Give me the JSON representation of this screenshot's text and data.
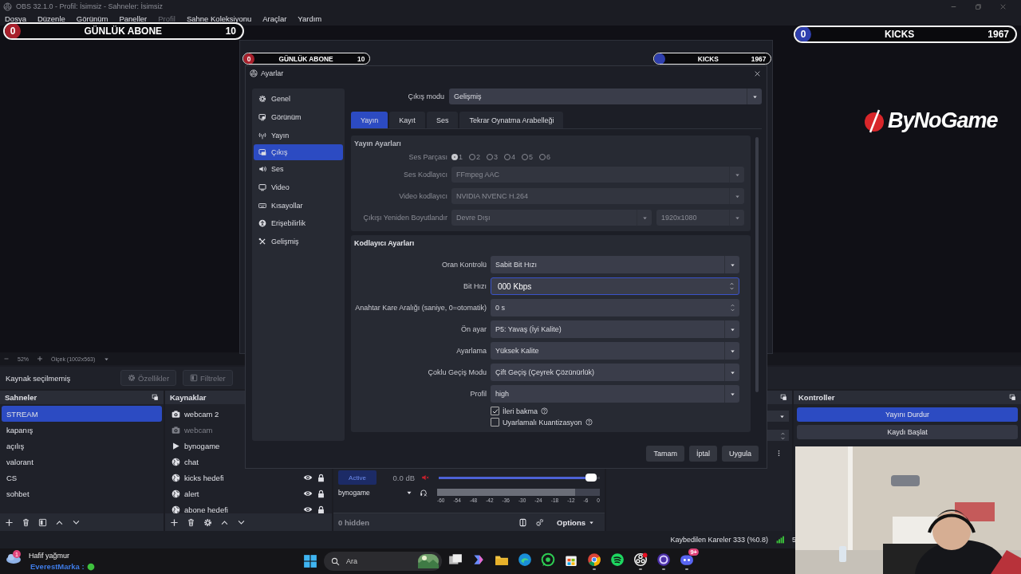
{
  "window": {
    "title": "OBS 32.1.0 - Profil: İsimsiz - Sahneler: İsimsiz"
  },
  "menu": [
    {
      "label": "Dosya",
      "disabled": false
    },
    {
      "label": "Düzenle",
      "disabled": false
    },
    {
      "label": "Görünüm",
      "disabled": false
    },
    {
      "label": "Paneller",
      "disabled": false
    },
    {
      "label": "Profil",
      "disabled": true
    },
    {
      "label": "Sahne Koleksiyonu",
      "disabled": false
    },
    {
      "label": "Araçlar",
      "disabled": false
    },
    {
      "label": "Yardım",
      "disabled": false
    }
  ],
  "overlays": [
    {
      "count": "0",
      "label": "GÜNLÜK ABONE",
      "goal": "10",
      "color": "#a8202c"
    },
    {
      "count": "0",
      "label": "KICKS",
      "goal": "1967",
      "color": "#2f3fae"
    }
  ],
  "preview": {
    "logo": "ByNoGame",
    "nested_overlays": [
      {
        "count": "0",
        "label": "GÜNLÜK ABONE",
        "goal": "10",
        "color": "#a8202c"
      },
      {
        "label": "KICKS",
        "goal": "1967",
        "color": "#2f3fae"
      }
    ]
  },
  "zoom_bar": {
    "zoom": "52%",
    "scale": "Ölçek (1002x563)"
  },
  "source_toolbar": {
    "status": "Kaynak seçilmemiş",
    "buttons": [
      {
        "label": "Özellikler",
        "disabled": true
      },
      {
        "label": "Filtreler",
        "disabled": true
      }
    ]
  },
  "scenes": {
    "title": "Sahneler",
    "items": [
      {
        "label": "STREAM",
        "selected": true
      },
      {
        "label": "kapanış",
        "selected": false
      },
      {
        "label": "açılış",
        "selected": false
      },
      {
        "label": "valorant",
        "selected": false
      },
      {
        "label": "CS",
        "selected": false
      },
      {
        "label": "sohbet",
        "selected": false
      }
    ]
  },
  "sources": {
    "title": "Kaynaklar",
    "items": [
      {
        "label": "webcam 2",
        "kind": "camera",
        "visible": true
      },
      {
        "label": "webcam",
        "kind": "camera",
        "visible": false
      },
      {
        "label": "bynogame",
        "kind": "media",
        "visible": true
      },
      {
        "label": "chat",
        "kind": "browser",
        "visible": true
      },
      {
        "label": "kicks hedefi",
        "kind": "browser",
        "visible": true,
        "controls": true
      },
      {
        "label": "alert",
        "kind": "browser",
        "visible": true,
        "controls": true
      },
      {
        "label": "abone hedefi",
        "kind": "browser",
        "visible": true,
        "controls": true
      }
    ]
  },
  "mixer": {
    "channel": {
      "status": "Active",
      "volume": "0.0 dB",
      "level": 0.98,
      "name": "bynogame",
      "muted": true,
      "meter": {
        "level": 0.85,
        "ticks": [
          "-60",
          "-54",
          "-48",
          "-42",
          "-36",
          "-30",
          "-24",
          "-18",
          "-12",
          "-6",
          "0"
        ]
      }
    },
    "hidden": "0 hidden",
    "options": "Options"
  },
  "controls": {
    "title": "Kontroller",
    "buttons": [
      {
        "label": "Yayını Durdur",
        "active": true
      },
      {
        "label": "Kaydı Başlat",
        "active": false
      }
    ]
  },
  "status_bar": {
    "dropped_frames": "Kaybedilen Kareler 333 (%0.8)",
    "cut_text": "5"
  },
  "taskbar": {
    "weather": "Hafif yağmur",
    "weather_badge": "1",
    "chat_overlay": "EverestMarka :",
    "search": {
      "placeholder": "Ara"
    },
    "apps": [
      {
        "kind": "taskview",
        "active": false
      },
      {
        "kind": "copilot",
        "active": false
      },
      {
        "kind": "folder",
        "active": false
      },
      {
        "kind": "edge",
        "active": false
      },
      {
        "kind": "whatsapp",
        "active": false
      },
      {
        "kind": "store",
        "active": false
      },
      {
        "kind": "chrome",
        "active": true
      },
      {
        "kind": "spotify",
        "active": false
      },
      {
        "kind": "obs",
        "active": true
      },
      {
        "kind": "ring",
        "active": true
      },
      {
        "kind": "discord",
        "active": true,
        "badge": "9+"
      }
    ]
  },
  "settings": {
    "title": "Ayarlar",
    "nav": [
      {
        "label": "Genel",
        "selected": false
      },
      {
        "label": "Görünüm",
        "selected": false
      },
      {
        "label": "Yayın",
        "selected": false
      },
      {
        "label": "Çıkış",
        "selected": true
      },
      {
        "label": "Ses",
        "selected": false
      },
      {
        "label": "Video",
        "selected": false
      },
      {
        "label": "Kısayollar",
        "selected": false
      },
      {
        "label": "Erişebilirlik",
        "selected": false
      },
      {
        "label": "Gelişmiş",
        "selected": false
      }
    ],
    "output_mode": {
      "label": "Çıkış modu",
      "value": "Gelişmiş"
    },
    "tabs": [
      {
        "label": "Yayın",
        "selected": true
      },
      {
        "label": "Kayıt",
        "selected": false
      },
      {
        "label": "Ses",
        "selected": false
      },
      {
        "label": "Tekrar Oynatma Arabelleği",
        "selected": false
      }
    ],
    "stream_group": {
      "title": "Yayın Ayarları",
      "disabled": true,
      "audio_track": {
        "label": "Ses Parçası",
        "options": [
          {
            "label": "1",
            "selected": true
          },
          {
            "label": "2",
            "selected": false
          },
          {
            "label": "3",
            "selected": false
          },
          {
            "label": "4",
            "selected": false
          },
          {
            "label": "5",
            "selected": false
          },
          {
            "label": "6",
            "selected": false
          }
        ]
      },
      "rows": [
        {
          "label": "Ses Kodlayıcı",
          "values": [
            "FFmpeg AAC"
          ]
        },
        {
          "label": "Video kodlayıcı",
          "values": [
            "NVIDIA NVENC H.264"
          ]
        },
        {
          "label": "Çıkışı Yeniden Boyutlandır",
          "values": [
            "Devre Dışı",
            "1920x1080"
          ]
        }
      ]
    },
    "encoder_group": {
      "title": "Kodlayıcı Ayarları",
      "rows": [
        {
          "label": "Oran Kontrolü",
          "kind": "select",
          "value": "Sabit Bit Hızı",
          "focused": false
        },
        {
          "label": "Bit Hızı",
          "kind": "spin",
          "value": "000 Kbps",
          "focused": true
        },
        {
          "label": "Anahtar Kare Aralığı (saniye, 0=otomatik)",
          "kind": "spin",
          "value": "0 s",
          "focused": false
        },
        {
          "label": "Ön ayar",
          "kind": "select",
          "value": "P5: Yavaş (İyi Kalite)",
          "focused": false
        },
        {
          "label": "Ayarlama",
          "kind": "select",
          "value": "Yüksek Kalite",
          "focused": false
        },
        {
          "label": "Çoklu Geçiş Modu",
          "kind": "select",
          "value": "Çift Geçiş (Çeyrek Çözünürlük)",
          "focused": false
        },
        {
          "label": "Profil",
          "kind": "select",
          "value": "high",
          "focused": false
        }
      ],
      "checkboxes": [
        {
          "label": "İleri bakma",
          "checked": true
        },
        {
          "label": "Uyarlamalı Kuantizasyon",
          "checked": false
        }
      ]
    },
    "buttons": [
      "Tamam",
      "İptal",
      "Uygula"
    ]
  }
}
